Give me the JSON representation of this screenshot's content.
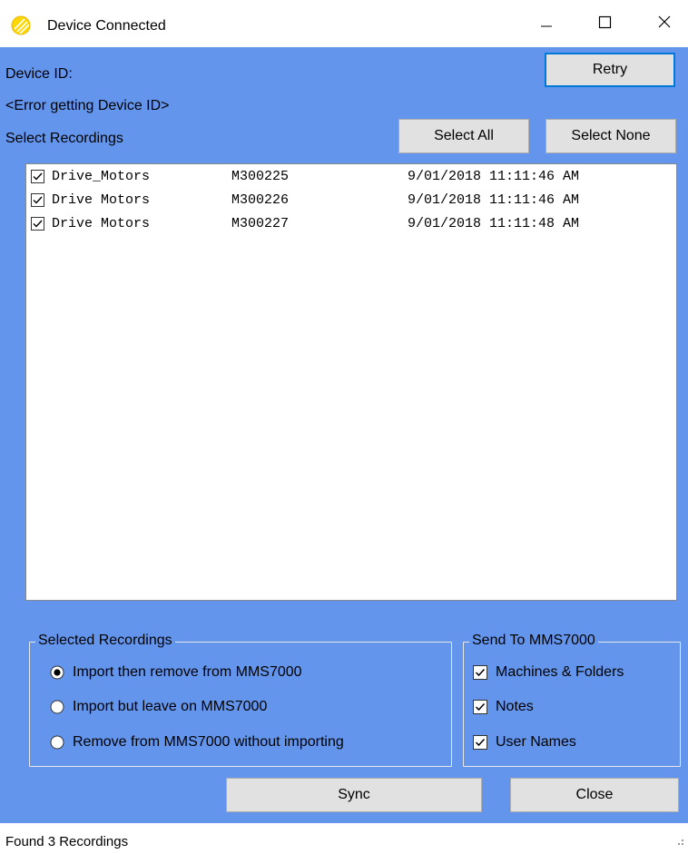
{
  "window": {
    "title": "Device Connected",
    "icon": "app-logo-icon",
    "controls": [
      "minimize-icon",
      "maximize-icon",
      "close-icon"
    ]
  },
  "device": {
    "id_label": "Device ID:",
    "id_value": "<Error getting Device ID>",
    "retry_label": "Retry"
  },
  "recordings": {
    "section_label": "Select Recordings",
    "select_all_label": "Select All",
    "select_none_label": "Select None",
    "items": [
      {
        "name": "Drive_Motors",
        "code": "M300225",
        "datetime": "9/01/2018 11:11:46 AM",
        "checked": true
      },
      {
        "name": "Drive Motors",
        "code": "M300226",
        "datetime": "9/01/2018 11:11:46 AM",
        "checked": true
      },
      {
        "name": "Drive Motors",
        "code": "M300227",
        "datetime": "9/01/2018 11:11:48 AM",
        "checked": true
      }
    ]
  },
  "selected_group": {
    "legend": "Selected Recordings",
    "options": [
      {
        "label": "Import then remove from MMS7000",
        "selected": true
      },
      {
        "label": "Import but leave on MMS7000",
        "selected": false
      },
      {
        "label": "Remove from MMS7000 without importing",
        "selected": false
      }
    ]
  },
  "send_group": {
    "legend": "Send To MMS7000",
    "options": [
      {
        "label": "Machines & Folders",
        "checked": true
      },
      {
        "label": "Notes",
        "checked": true
      },
      {
        "label": "User Names",
        "checked": true
      }
    ]
  },
  "actions": {
    "sync_label": "Sync",
    "close_label": "Close"
  },
  "status": {
    "text": "Found 3 Recordings"
  },
  "colors": {
    "client_background": "#6495ed",
    "title_background": "#ffffff",
    "button_face": "#e1e1e1",
    "default_button_border": "#0078d7",
    "icon_yellow": "#ffd700"
  }
}
